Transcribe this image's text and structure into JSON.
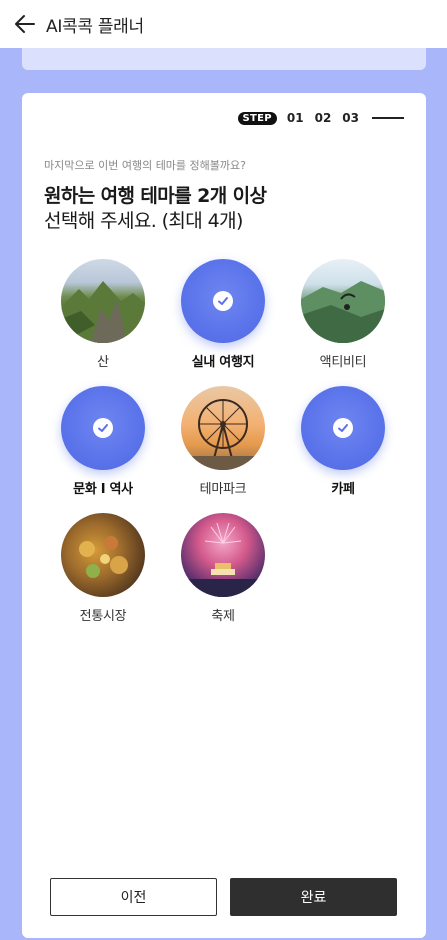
{
  "header": {
    "title": "AI콕콕 플래너",
    "back_icon": "arrow-left-icon"
  },
  "steps": {
    "badge": "STEP",
    "items": [
      "01",
      "02",
      "03"
    ]
  },
  "question": {
    "subtitle": "마지막으로 이번 여행의 테마를 정해볼까요?",
    "headline": "원하는 여행 테마를 2개 이상",
    "subhead": "선택해 주세요. (최대 4개)"
  },
  "themes": [
    {
      "label": "산",
      "selected": false
    },
    {
      "label": "실내 여행지",
      "selected": true
    },
    {
      "label": "액티비티",
      "selected": false
    },
    {
      "label": "문화 I 역사",
      "selected": true
    },
    {
      "label": "테마파크",
      "selected": false
    },
    {
      "label": "카페",
      "selected": true
    },
    {
      "label": "전통시장",
      "selected": false
    },
    {
      "label": "축제",
      "selected": false
    }
  ],
  "buttons": {
    "prev": "이전",
    "done": "완료"
  },
  "colors": {
    "background": "#a9b6f9",
    "accent": "#5a73ea",
    "dark_button": "#2f2f2f"
  }
}
